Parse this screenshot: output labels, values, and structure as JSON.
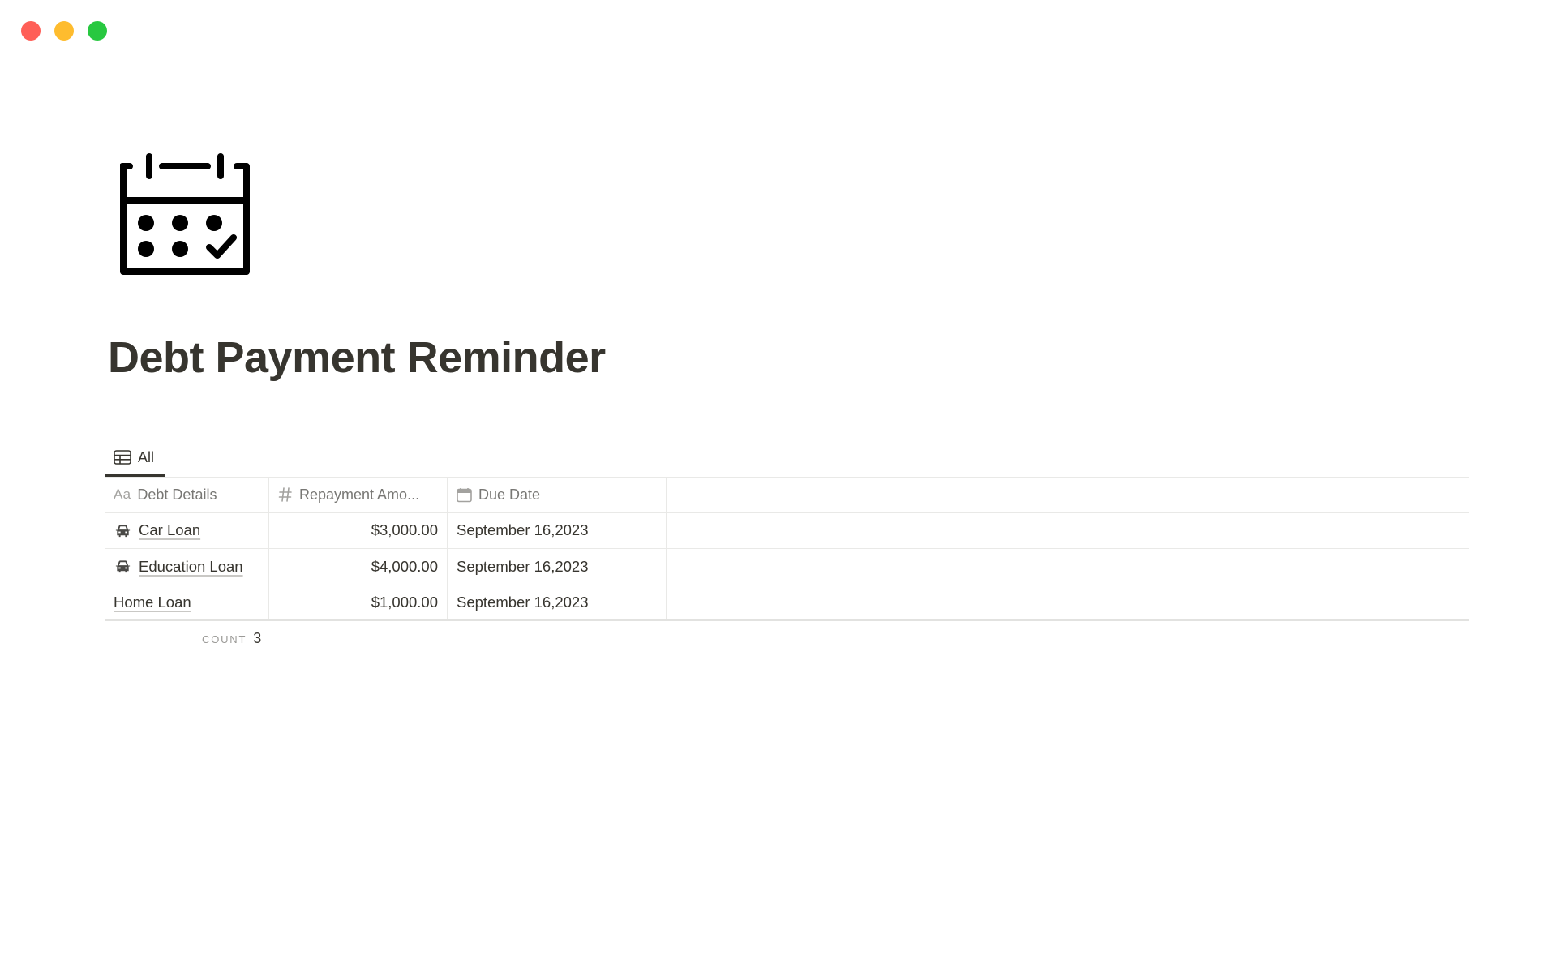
{
  "window": {
    "traffic_lights": [
      "close",
      "minimize",
      "zoom"
    ]
  },
  "page": {
    "icon": "calendar-check-icon",
    "title": "Debt Payment Reminder"
  },
  "views": {
    "tabs": [
      {
        "label": "All",
        "icon": "table-icon",
        "active": true
      }
    ]
  },
  "table": {
    "columns": [
      {
        "label": "Debt Details",
        "icon": "Aa"
      },
      {
        "label": "Repayment Amo...",
        "icon": "number-icon"
      },
      {
        "label": "Due Date",
        "icon": "calendar-icon"
      }
    ],
    "rows": [
      {
        "name": "Car Loan",
        "icon": "car-icon",
        "amount": "$3,000.00",
        "due": "September 16,2023"
      },
      {
        "name": "Education Loan",
        "icon": "car-icon",
        "amount": "$4,000.00",
        "due": "September 16,2023"
      },
      {
        "name": "Home Loan",
        "icon": "",
        "amount": "$1,000.00",
        "due": "September 16,2023"
      }
    ],
    "footer": {
      "count_label": "COUNT",
      "count_value": "3"
    }
  },
  "colors": {
    "text": "#37352f",
    "muted": "#787774",
    "border": "#e9e9e7",
    "close": "#ff5f57",
    "minimize": "#febc2e",
    "zoom": "#28c840"
  }
}
